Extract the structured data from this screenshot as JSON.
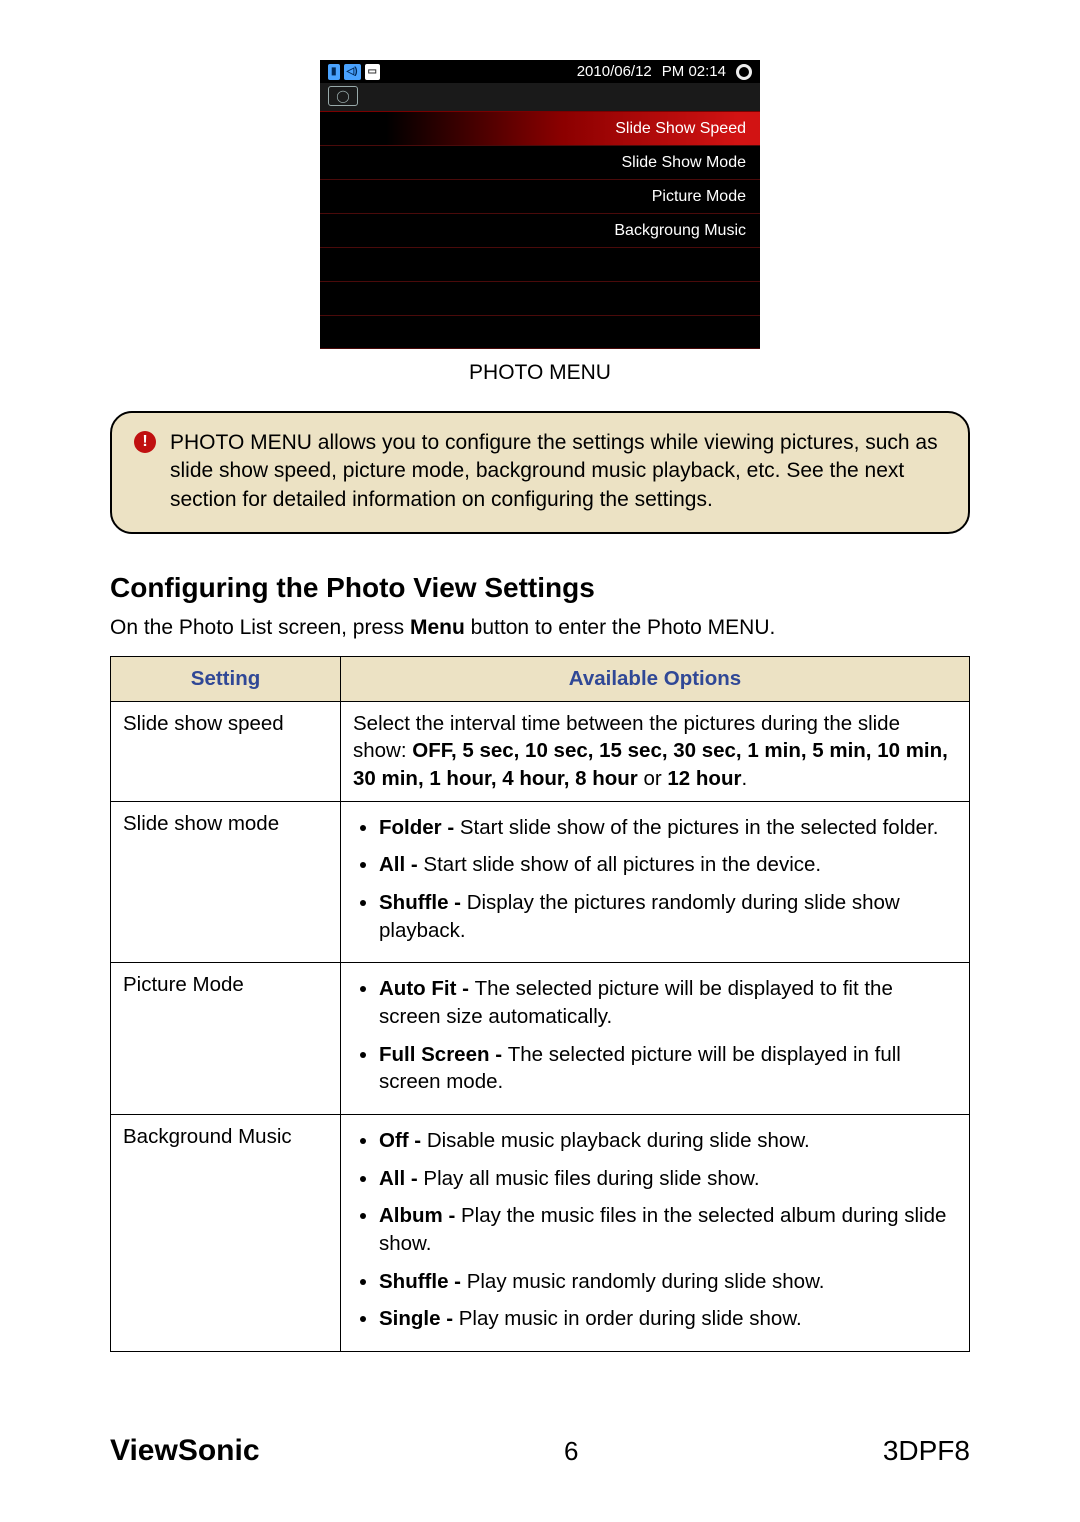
{
  "screenshot": {
    "date": "2010/06/12",
    "time": "PM 02:14",
    "status_icons": [
      "sd-card-icon",
      "sound-icon",
      "memory-icon"
    ],
    "tab_icon": "photo-tab-icon",
    "rows": [
      {
        "label": "Slide Show Speed",
        "highlight": true
      },
      {
        "label": "Slide Show Mode",
        "highlight": false
      },
      {
        "label": "Picture Mode",
        "highlight": false
      },
      {
        "label": "Backgroung Music",
        "highlight": false
      },
      {
        "label": "",
        "highlight": false
      },
      {
        "label": "",
        "highlight": false
      },
      {
        "label": "",
        "highlight": false
      }
    ]
  },
  "photo_menu_caption": "PHOTO MENU",
  "callout_text": "PHOTO MENU allows you to configure the settings while viewing pictures, such as slide show speed, picture mode, background music playback, etc. See the next section for detailed information on configuring the settings.",
  "section_heading": "Configuring the Photo View Settings",
  "intro_prefix": "On the Photo List screen, press ",
  "intro_bold": "Menu",
  "intro_suffix": " button to enter the Photo MENU.",
  "table": {
    "header_setting": "Setting",
    "header_options": "Available Options",
    "rows": {
      "speed": {
        "label": "Slide show speed",
        "desc_prefix": "Select the interval time between the pictures during the slide show: ",
        "desc_bold": "OFF, 5 sec, 10 sec, 15 sec, 30 sec, 1 min, 5 min, 10 min, 30 min, 1 hour, 4 hour, 8 hour",
        "desc_mid": " or ",
        "desc_bold2": "12 hour",
        "desc_suffix": "."
      },
      "mode": {
        "label": "Slide show mode",
        "items": [
          {
            "bold": "Folder - ",
            "text": "Start slide show of the pictures in the selected folder."
          },
          {
            "bold": "All - ",
            "text": "Start slide show of all pictures in the device."
          },
          {
            "bold": "Shuffle - ",
            "text": "Display the pictures randomly during slide show playback."
          }
        ]
      },
      "picture": {
        "label": "Picture Mode",
        "items": [
          {
            "bold": "Auto Fit - ",
            "text": "The selected picture will be displayed to fit the screen size automatically."
          },
          {
            "bold": "Full Screen - ",
            "text": "The selected picture will be displayed in full screen mode."
          }
        ]
      },
      "bgmusic": {
        "label": "Background Music",
        "items": [
          {
            "bold": "Off - ",
            "text": "Disable music playback during slide show."
          },
          {
            "bold": "All - ",
            "text": "Play all music files during slide show."
          },
          {
            "bold": "Album - ",
            "text": "Play the music files in the selected album during slide show."
          },
          {
            "bold": "Shuffle - ",
            "text": "Play music randomly during slide show."
          },
          {
            "bold": "Single - ",
            "text": "Play music in order during slide show."
          }
        ]
      }
    }
  },
  "footer": {
    "brand": "ViewSonic",
    "page": "6",
    "model": "3DPF8"
  }
}
